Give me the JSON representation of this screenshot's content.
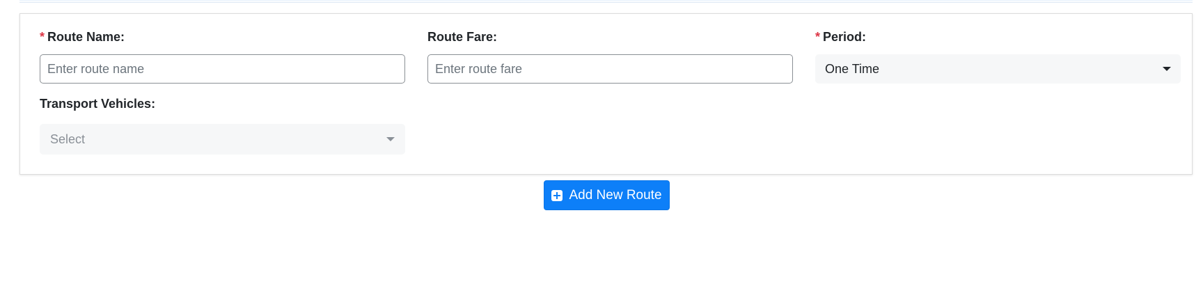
{
  "form": {
    "route_name": {
      "required_mark": "*",
      "label": "Route Name:",
      "placeholder": "Enter route name",
      "value": ""
    },
    "route_fare": {
      "label": "Route Fare:",
      "placeholder": "Enter route fare",
      "value": ""
    },
    "period": {
      "required_mark": "*",
      "label": "Period:",
      "selected": "One Time",
      "icon": "chevron-down-icon"
    },
    "transport_vehicles": {
      "label": "Transport Vehicles:",
      "placeholder": "Select",
      "icon": "chevron-down-icon"
    }
  },
  "actions": {
    "add_route_label": "Add New Route",
    "add_route_icon": "plus-square-icon"
  },
  "colors": {
    "primary": "#0d7ff8",
    "required": "#dc3545"
  }
}
